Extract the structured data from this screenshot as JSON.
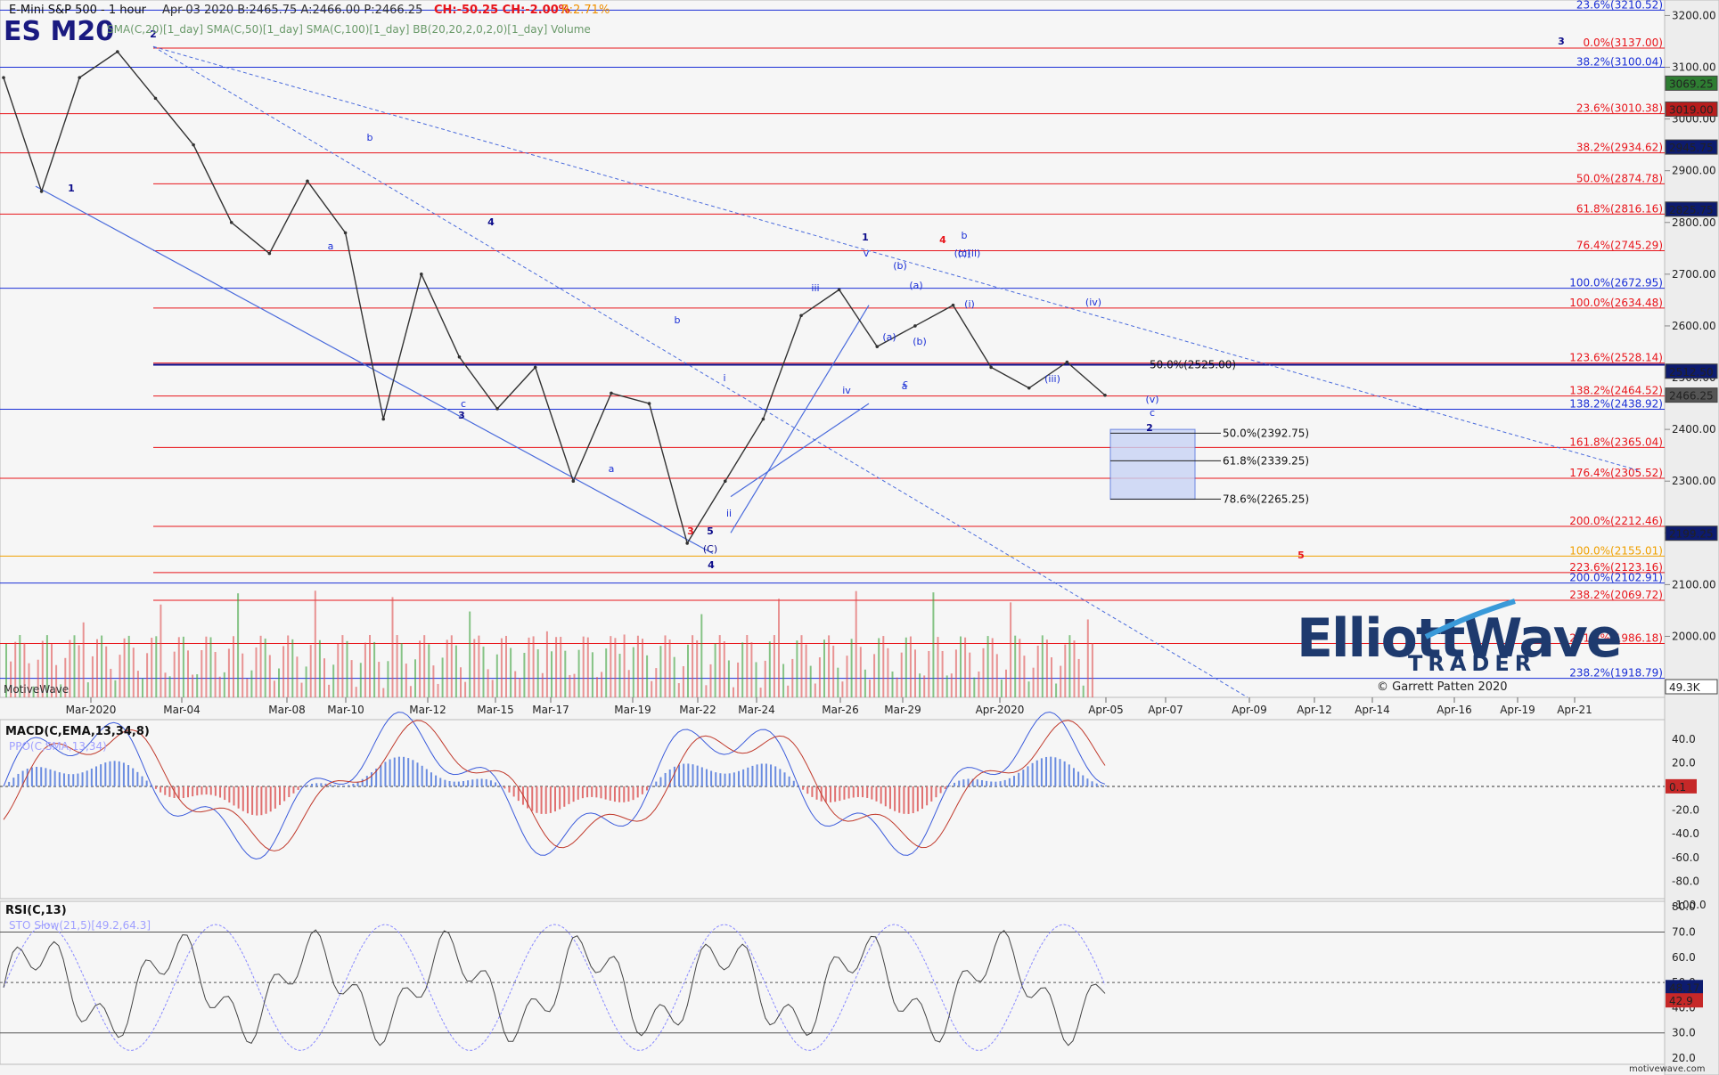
{
  "header": {
    "title": "E-Mini S&P 500 - 1 hour",
    "quote": "Apr-03 2020  B:2465.75  A:2466.00  P:2466.25",
    "change": "CH:-50.25  CH:-2.00%",
    "range": "R:2.71%",
    "symbol": "ES M20",
    "indicators": "SMA(C,20)[1_day]  SMA(C,50)[1_day]  SMA(C,100)[1_day]  BB(20,20,2,0,2,0)[1_day]  Volume",
    "watermark_left": "MotiveWave",
    "watermark_right": "motivewave.com",
    "copyright": "© Garrett Patten 2020",
    "logo_line1": "ElliottWave",
    "logo_line2": "TRADER"
  },
  "colors": {
    "background": "#f4f4f4",
    "fib_red": "#e8151b",
    "fib_blue": "#1a2fd6",
    "fib_navy": "#0b0b8a",
    "fib_purple": "#7b1fa2",
    "fib_orange": "#f0a000",
    "candle": "#333333",
    "vol_green": "#3aa13a",
    "vol_red": "#e05050",
    "macd_blue": "#3b5bdb",
    "macd_red": "#c0392b",
    "rsi": "#444444",
    "sto": "#8a8aff"
  },
  "price_axis": {
    "ticks": [
      "3200.00",
      "3100.00",
      "3000.00",
      "2900.00",
      "2800.00",
      "2700.00",
      "2600.00",
      "2500.00",
      "2400.00",
      "2300.00",
      "2200.00",
      "2100.00",
      "2000.00"
    ],
    "badges": [
      {
        "text": "3069.25",
        "bg": "#2e7d32"
      },
      {
        "text": "3019.00",
        "bg": "#b71c1c"
      },
      {
        "text": "2945.75",
        "bg": "#0d1b6e"
      },
      {
        "text": "2825.75",
        "bg": "#0d1b6e"
      },
      {
        "text": "2512.50",
        "bg": "#0d1b6e"
      },
      {
        "text": "2466.25",
        "bg": "#555555"
      },
      {
        "text": "2199.25",
        "bg": "#0d1b6e"
      },
      {
        "text": "49.3K",
        "bg": "#ffffff"
      }
    ]
  },
  "fib_levels": [
    {
      "label": "23.6%(3210.52)",
      "color": "#1a2fd6"
    },
    {
      "label": "0.0%(3137.00)",
      "color": "#e8151b"
    },
    {
      "label": "38.2%(3100.04)",
      "color": "#1a2fd6"
    },
    {
      "label": "23.6%(3010.38)",
      "color": "#e8151b"
    },
    {
      "label": "38.2%(2934.62)",
      "color": "#e8151b"
    },
    {
      "label": "50.0%(2874.78)",
      "color": "#e8151b"
    },
    {
      "label": "61.8%(2816.16)",
      "color": "#e8151b"
    },
    {
      "label": "76.4%(2745.29)",
      "color": "#e8151b"
    },
    {
      "label": "100.0%(2672.95)",
      "color": "#1a2fd6"
    },
    {
      "label": "100.0%(2634.48)",
      "color": "#e8151b"
    },
    {
      "label": "123.6%(2528.14)",
      "color": "#e8151b"
    },
    {
      "label": "138.2%(2464.52)",
      "color": "#e8151b"
    },
    {
      "label": "138.2%(2438.92)",
      "color": "#1a2fd6"
    },
    {
      "label": "161.8%(2365.04)",
      "color": "#e8151b"
    },
    {
      "label": "176.4%(2305.52)",
      "color": "#e8151b"
    },
    {
      "label": "200.0%(2212.46)",
      "color": "#e8151b"
    },
    {
      "label": "100.0%(2155.01)",
      "color": "#f0a000"
    },
    {
      "label": "223.6%(2123.16)",
      "color": "#e8151b"
    },
    {
      "label": "200.0%(2102.91)",
      "color": "#1a2fd6"
    },
    {
      "label": "238.2%(2069.72)",
      "color": "#e8151b"
    },
    {
      "label": "261.8%(1986.18)",
      "color": "#e8151b"
    },
    {
      "label": "238.2%(1918.79)",
      "color": "#1a2fd6"
    }
  ],
  "target_box": {
    "fibs": [
      "50.0%(2392.75)",
      "61.8%(2339.25)",
      "78.6%(2265.25)"
    ],
    "mid": "50.0%(2525.00)"
  },
  "dates": [
    "Mar-2020",
    "Mar-04",
    "Mar-08",
    "Mar-10",
    "Mar-12",
    "Mar-15",
    "Mar-17",
    "Mar-19",
    "Mar-22",
    "Mar-24",
    "Mar-26",
    "Mar-29",
    "Apr-2020",
    "Apr-05",
    "Apr-07",
    "Apr-09",
    "Apr-12",
    "Apr-14",
    "Apr-16",
    "Apr-19",
    "Apr-21"
  ],
  "macd": {
    "title": "MACD(C,EMA,13,34,8)",
    "sub": "PPO(C,SMA,13,34)",
    "ticks": [
      "40.0",
      "20.0",
      "-20.0",
      "-40.0",
      "-60.0",
      "-80.0",
      "-100.0"
    ],
    "badge": "0.1"
  },
  "rsi": {
    "title": "RSI(C,13)",
    "sub": "STO Slow(21,5)[49.2,64.3]",
    "ticks": [
      "80.0",
      "70.0",
      "60.0",
      "50.0",
      "40.0",
      "30.0",
      "20.0"
    ],
    "badges": [
      "48.17",
      "42.9"
    ]
  },
  "waves": [
    {
      "text": "1",
      "color": "#0b0b8a"
    },
    {
      "text": "2",
      "color": "#0b0b8a"
    },
    {
      "text": "3",
      "color": "#0b0b8a"
    },
    {
      "text": "4",
      "color": "#0b0b8a"
    },
    {
      "text": "5",
      "color": "#0b0b8a"
    },
    {
      "text": "1",
      "color": "#0b0b8a"
    },
    {
      "text": "2",
      "color": "#0b0b8a"
    },
    {
      "text": "3",
      "color": "#0b0b8a"
    },
    {
      "text": "3",
      "color": "#e8151b"
    },
    {
      "text": "4",
      "color": "#e8151b"
    },
    {
      "text": "5",
      "color": "#e8151b"
    },
    {
      "text": "a",
      "color": "#1a2fd6"
    },
    {
      "text": "b",
      "color": "#1a2fd6"
    },
    {
      "text": "c",
      "color": "#1a2fd6"
    },
    {
      "text": "a",
      "color": "#1a2fd6"
    },
    {
      "text": "b",
      "color": "#1a2fd6"
    },
    {
      "text": "c",
      "color": "#1a2fd6"
    },
    {
      "text": "i",
      "color": "#1a2fd6"
    },
    {
      "text": "ii",
      "color": "#1a2fd6"
    },
    {
      "text": "iii",
      "color": "#1a2fd6"
    },
    {
      "text": "iv",
      "color": "#1a2fd6"
    },
    {
      "text": "v",
      "color": "#1a2fd6"
    },
    {
      "text": "(a)",
      "color": "#1a2fd6"
    },
    {
      "text": "(b)",
      "color": "#1a2fd6"
    },
    {
      "text": "(c)",
      "color": "#1a2fd6"
    },
    {
      "text": "(a)",
      "color": "#1a2fd6"
    },
    {
      "text": "(b)",
      "color": "#1a2fd6"
    },
    {
      "text": "a",
      "color": "#1a2fd6"
    },
    {
      "text": "b",
      "color": "#1a2fd6"
    },
    {
      "text": "(c)",
      "color": "#1a2fd6"
    },
    {
      "text": "(i)",
      "color": "#1a2fd6"
    },
    {
      "text": "(ii)",
      "color": "#1a2fd6"
    },
    {
      "text": "(iii)",
      "color": "#1a2fd6"
    },
    {
      "text": "(iv)",
      "color": "#1a2fd6"
    },
    {
      "text": "(v)",
      "color": "#1a2fd6"
    },
    {
      "text": "c",
      "color": "#1a2fd6"
    },
    {
      "text": "(C)",
      "color": "#0b0b8a"
    },
    {
      "text": "4",
      "color": "#0b0b8a"
    }
  ],
  "chart_data": {
    "type": "line",
    "title": "E-Mini S&P 500 - 1 hour",
    "xlabel": "",
    "ylabel": "",
    "ylim": [
      1900,
      3230
    ],
    "x": [
      "Feb-28",
      "Mar-02",
      "Mar-03",
      "Mar-04",
      "Mar-05",
      "Mar-06",
      "Mar-08",
      "Mar-09",
      "Mar-10",
      "Mar-11",
      "Mar-12",
      "Mar-13",
      "Mar-15",
      "Mar-16",
      "Mar-17",
      "Mar-18",
      "Mar-19",
      "Mar-20",
      "Mar-22",
      "Mar-23",
      "Mar-24",
      "Mar-25",
      "Mar-26",
      "Mar-27",
      "Mar-29",
      "Mar-30",
      "Mar-31",
      "Apr-01",
      "Apr-02",
      "Apr-03"
    ],
    "series": [
      {
        "values": [
          3080,
          2860,
          3080,
          3130,
          3040,
          2950,
          2800,
          2740,
          2880,
          2780,
          2420,
          2700,
          2540,
          2440,
          2520,
          2300,
          2470,
          2450,
          2180,
          2300,
          2420,
          2620,
          2670,
          2560,
          2600,
          2640,
          2520,
          2480,
          2530,
          2466
        ]
      }
    ]
  }
}
